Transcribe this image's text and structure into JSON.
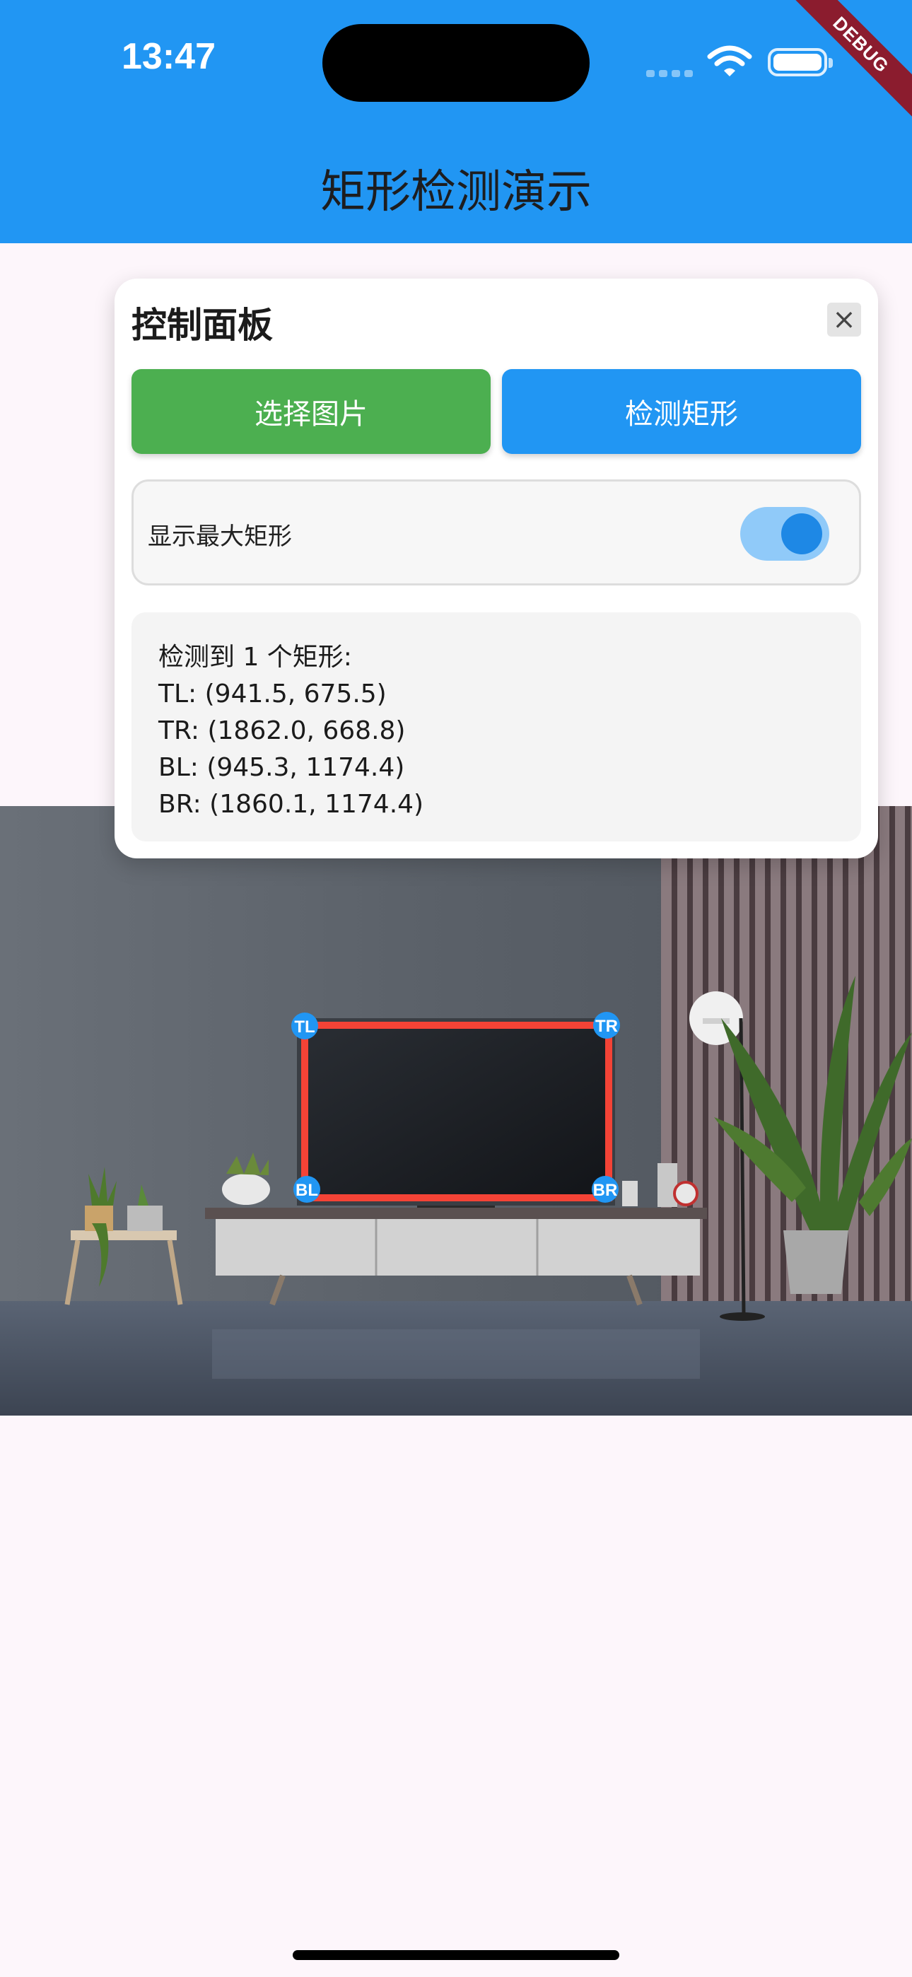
{
  "status_bar": {
    "time": "13:47"
  },
  "debug_banner": "DEBUG",
  "app_bar": {
    "title": "矩形检测演示"
  },
  "panel": {
    "title": "控制面板",
    "close_label": "×",
    "select_button": "选择图片",
    "detect_button": "检测矩形",
    "toggle_label": "显示最大矩形",
    "toggle_on": true,
    "result_lines": [
      "检测到 1 个矩形:",
      "TL: (941.5, 675.5)",
      "TR: (1862.0, 668.8)",
      "BL: (945.3, 1174.4)",
      "BR: (1860.1, 1174.4)"
    ]
  },
  "corners": {
    "tl": "TL",
    "tr": "TR",
    "bl": "BL",
    "br": "BR"
  },
  "colors": {
    "app_bar": "#2196f3",
    "select_button": "#4caf50",
    "detect_button": "#2196f3",
    "rect_outline": "#f44336",
    "corner_marker": "#2196f3"
  }
}
